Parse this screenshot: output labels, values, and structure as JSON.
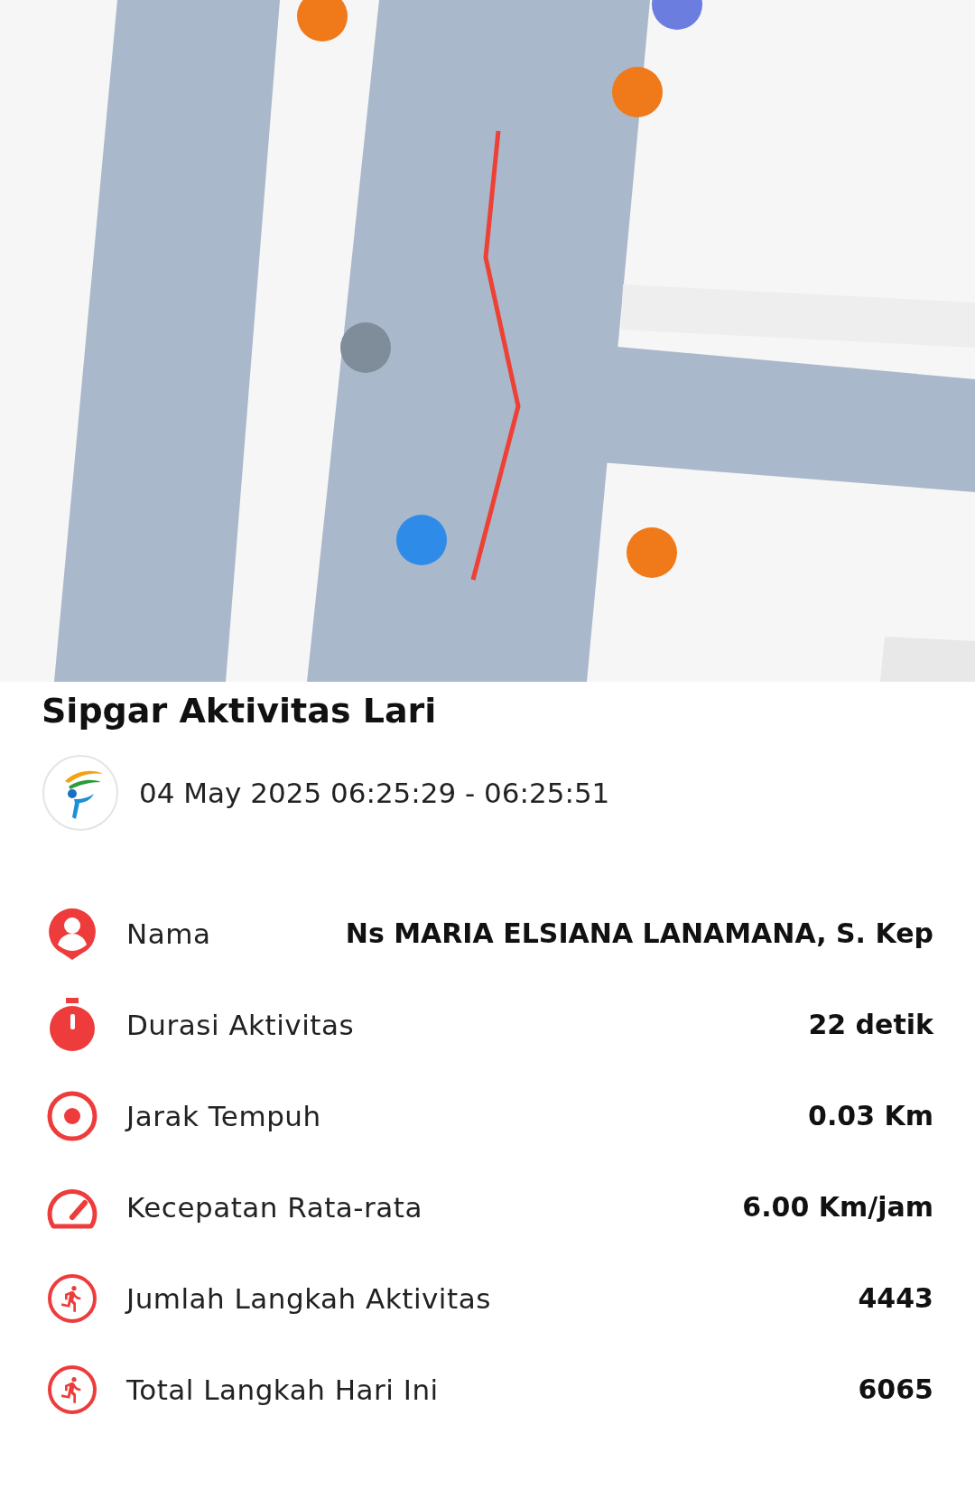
{
  "title": "Sipgar Aktivitas Lari",
  "date_range": "04 May 2025 06:25:29 - 06:25:51",
  "stats": [
    {
      "label": "Nama",
      "value": "Ns MARIA ELSIANA LANAMANA, S. Kep"
    },
    {
      "label": "Durasi Aktivitas",
      "value": "22 detik"
    },
    {
      "label": "Jarak Tempuh",
      "value": "0.03 Km"
    },
    {
      "label": "Kecepatan Rata-rata",
      "value": "6.00 Km/jam"
    },
    {
      "label": "Jumlah Langkah Aktivitas",
      "value": "4443"
    },
    {
      "label": "Total Langkah Hari Ini",
      "value": "6065"
    }
  ]
}
